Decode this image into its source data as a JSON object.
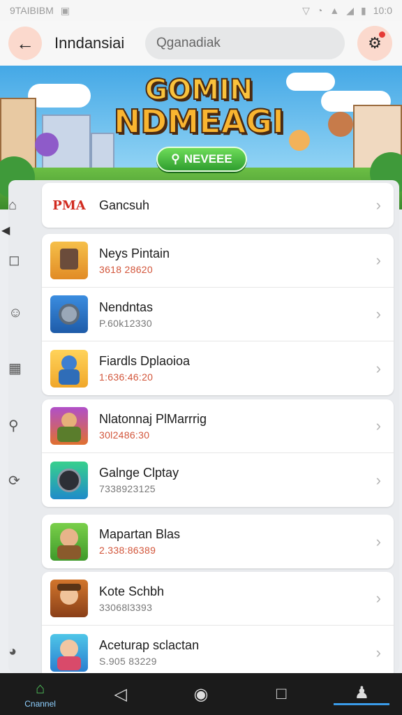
{
  "status_bar": {
    "left_text": "9TAIBIBM",
    "time": "10:0",
    "icons": [
      "photo-icon",
      "vpn-icon",
      "alarm-icon",
      "wifi-icon",
      "signal-icon",
      "battery-icon"
    ]
  },
  "app_bar": {
    "title": "Inndansiai",
    "search_placeholder": "Qganadiak"
  },
  "banner": {
    "title_line1": "GOMIN",
    "title_line2": "NDMEAGI",
    "button_label": "NEVEEE"
  },
  "featured": {
    "name": "Gancsuh",
    "logo_text": "PMA"
  },
  "groups": [
    {
      "items": [
        {
          "name": "Neys Pintain",
          "meta": "3618 28620",
          "thumb": "robot-icon"
        },
        {
          "name": "Nendntas",
          "meta": "P.60k12330",
          "thumb": "gear-ball-icon"
        },
        {
          "name": "Fiardls Dplaoioa",
          "meta": "1:636:46:20",
          "thumb": "hero-icon"
        }
      ]
    },
    {
      "items": [
        {
          "name": "Nlatonnaj PlMarrrig",
          "meta": "30l2486:30",
          "thumb": "warrior-icon"
        },
        {
          "name": "Galnge Clptay",
          "meta": "7338923125",
          "thumb": "orb-icon"
        }
      ]
    },
    {
      "items": [
        {
          "name": "Mapartan Blas",
          "meta": "2.338:86389",
          "thumb": "adventurer-icon"
        }
      ]
    },
    {
      "items": [
        {
          "name": "Kote Schbh",
          "meta": "33068l3393",
          "thumb": "explorer-icon"
        },
        {
          "name": "Aceturap sclactan",
          "meta": "S.905 83229",
          "thumb": "girl-icon"
        }
      ]
    }
  ],
  "rail": [
    "home-icon",
    "chat-icon",
    "emoji-icon",
    "calendar-icon",
    "search-icon",
    "refresh-icon",
    "gauge-icon"
  ],
  "nav": {
    "home_label": "Cnannel"
  },
  "colors": {
    "accent_soft": "#fbd9cd",
    "meta_text": "#d2553a",
    "nav_bg": "#1b1b1b"
  }
}
